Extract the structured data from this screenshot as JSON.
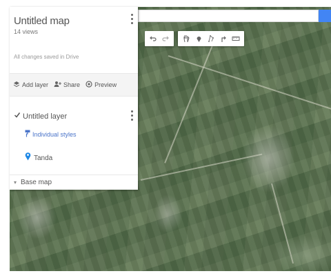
{
  "map": {
    "title": "Untitled map",
    "views": "14 views",
    "save_status": "All changes saved in Drive"
  },
  "actions": [
    {
      "label": "Add layer",
      "icon": "add-layer-icon"
    },
    {
      "label": "Share",
      "icon": "share-icon"
    },
    {
      "label": "Preview",
      "icon": "preview-icon"
    }
  ],
  "layer": {
    "name": "Untitled layer",
    "checked": true,
    "style_link": "Individual styles",
    "places": [
      {
        "name": "Tanda",
        "icon": "map-pin-icon",
        "color": "#1e88e5"
      }
    ]
  },
  "basemap": {
    "label": "Base map"
  },
  "toolbar": {
    "groups": [
      [
        "undo-icon",
        "redo-icon"
      ],
      [
        "hand-icon",
        "marker-icon",
        "draw-line-icon",
        "directions-icon",
        "ruler-icon"
      ]
    ]
  },
  "colors": {
    "accent": "#4285f4",
    "link": "#4a74c9",
    "pin": "#1e88e5"
  }
}
